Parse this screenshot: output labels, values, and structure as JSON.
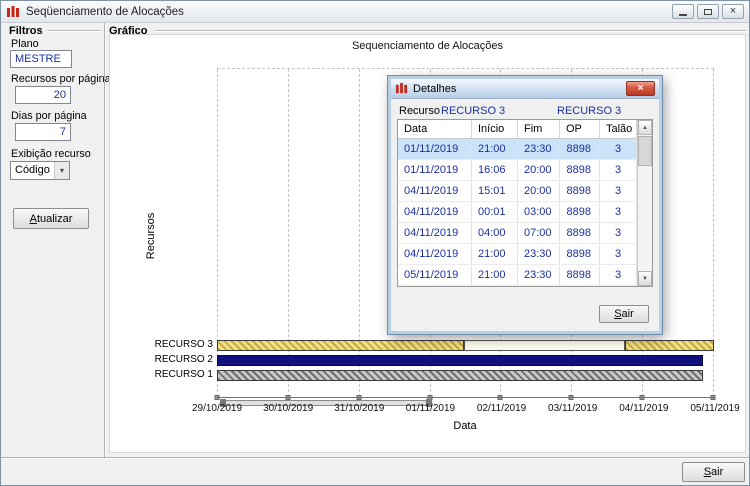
{
  "colors": {
    "value_navy": "#1c2f9f",
    "bar_yellow": "#f0e08a",
    "bar_navy": "#10107e",
    "bar_gray": "#c8c8c8",
    "selected_row_blue": "#cbe3f9",
    "dialog_close_red": "#c4422c",
    "app_icon_red": "#c5291d"
  },
  "icons": {
    "close": "×",
    "dialog_close": "×",
    "combo_arrow": "▾",
    "scroll_up": "▲",
    "scroll_down": "▼"
  },
  "window": {
    "title": "Seqüenciamento de Alocações"
  },
  "filters": {
    "group_label": "Filtros",
    "plano_label": "Plano",
    "plano_value": "MESTRE",
    "recursos_label": "Recursos por página",
    "recursos_value": "20",
    "dias_label": "Dias por página",
    "dias_value": "7",
    "exibicao_label": "Exibição recurso",
    "exibicao_value": "Código",
    "atualizar_button": {
      "accel": "A",
      "rest": "tualizar"
    }
  },
  "grafico": {
    "group_label": "Gráfico"
  },
  "chart_data": {
    "type": "bar",
    "subtype": "gantt",
    "title": "Sequenciamento de Alocações",
    "xlabel": "Data",
    "ylabel": "Recursos",
    "x_ticks": [
      "29/10/2019",
      "30/10/2019",
      "31/10/2019",
      "01/11/2019",
      "02/11/2019",
      "03/11/2019",
      "04/11/2019",
      "05/11/2019"
    ],
    "grid": "dashed",
    "rows": [
      {
        "name": "RECURSO 3",
        "segments": [
          {
            "from": "29/10/2019",
            "to": "01/11/2019 12:00",
            "style": "yellow-hatch",
            "x0": 0,
            "x1": 0.497
          },
          {
            "from": "01/11/2019 12:00",
            "to": "03/11/2019 18:00",
            "style": "selected-outline",
            "x0": 0.497,
            "x1": 0.82
          },
          {
            "from": "03/11/2019 18:00",
            "to": "05/11/2019",
            "style": "yellow-hatch",
            "x0": 0.82,
            "x1": 1.0
          }
        ]
      },
      {
        "name": "RECURSO 2",
        "segments": [
          {
            "from": "29/10/2019",
            "to": "05/11/2019",
            "style": "navy-solid",
            "x0": 0,
            "x1": 0.977
          }
        ]
      },
      {
        "name": "RECURSO 1",
        "segments": [
          {
            "from": "29/10/2019",
            "to": "05/11/2019",
            "style": "gray-hatch",
            "x0": 0,
            "x1": 0.977
          }
        ]
      }
    ]
  },
  "dialog": {
    "title": "Detalhes",
    "recurso_label": "Recurso",
    "recurso_value": "RECURSO 3",
    "recurso_value2": "RECURSO 3",
    "columns": [
      "Data",
      "Início",
      "Fim",
      "OP",
      "Talão"
    ],
    "rows": [
      [
        "01/11/2019",
        "21:00",
        "23:30",
        "8898",
        "3"
      ],
      [
        "01/11/2019",
        "16:06",
        "20:00",
        "8898",
        "3"
      ],
      [
        "04/11/2019",
        "15:01",
        "20:00",
        "8898",
        "3"
      ],
      [
        "04/11/2019",
        "00:01",
        "03:00",
        "8898",
        "3"
      ],
      [
        "04/11/2019",
        "04:00",
        "07:00",
        "8898",
        "3"
      ],
      [
        "04/11/2019",
        "21:00",
        "23:30",
        "8898",
        "3"
      ],
      [
        "05/11/2019",
        "21:00",
        "23:30",
        "8898",
        "3"
      ]
    ],
    "sair_button": {
      "accel": "S",
      "rest": "air"
    }
  },
  "footer": {
    "sair_button": {
      "accel": "S",
      "rest": "air"
    }
  }
}
